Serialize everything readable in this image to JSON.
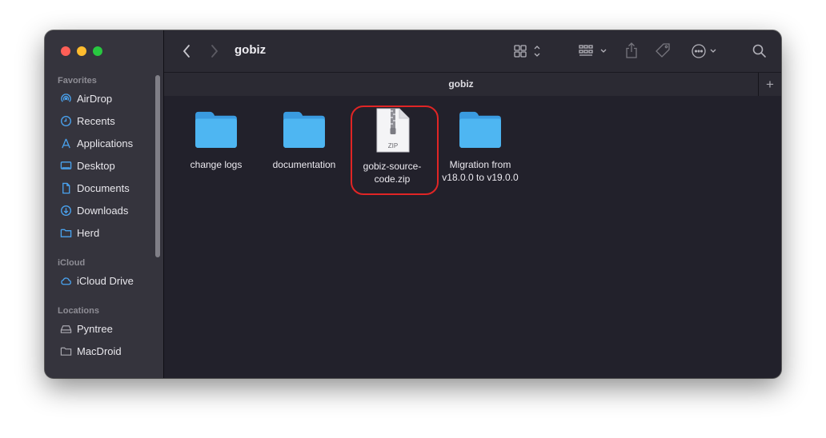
{
  "window": {
    "title": "gobiz",
    "tab_title": "gobiz",
    "new_tab_symbol": "+"
  },
  "toolbar": {
    "icons": [
      "back-arrow-icon",
      "forward-arrow-icon",
      "grid-view-icon",
      "group-by-icon",
      "share-icon",
      "tag-icon",
      "more-actions-icon",
      "search-icon"
    ]
  },
  "sidebar": {
    "sections": [
      {
        "label": "Favorites",
        "items": [
          {
            "label": "AirDrop",
            "icon": "airdrop-icon"
          },
          {
            "label": "Recents",
            "icon": "clock-icon"
          },
          {
            "label": "Applications",
            "icon": "applications-icon"
          },
          {
            "label": "Desktop",
            "icon": "desktop-icon"
          },
          {
            "label": "Documents",
            "icon": "document-icon"
          },
          {
            "label": "Downloads",
            "icon": "download-icon"
          },
          {
            "label": "Herd",
            "icon": "folder-icon"
          }
        ]
      },
      {
        "label": "iCloud",
        "items": [
          {
            "label": "iCloud Drive",
            "icon": "cloud-icon"
          }
        ]
      },
      {
        "label": "Locations",
        "items": [
          {
            "label": "Pyntree",
            "icon": "drive-icon"
          },
          {
            "label": "MacDroid",
            "icon": "folder-icon"
          }
        ]
      }
    ]
  },
  "files": [
    {
      "name": "change logs",
      "kind": "folder"
    },
    {
      "name": "documentation",
      "kind": "folder"
    },
    {
      "name_line1": "gobiz-source-",
      "name_line2": "code.zip",
      "kind": "zip",
      "badge": "ZIP",
      "highlighted": true
    },
    {
      "name_line1": "Migration from",
      "name_line2": "v18.0.0 to v19.0.0",
      "kind": "folder"
    }
  ],
  "colors": {
    "folder_blue": "#4eb6f2",
    "highlight_red": "#e02525"
  }
}
